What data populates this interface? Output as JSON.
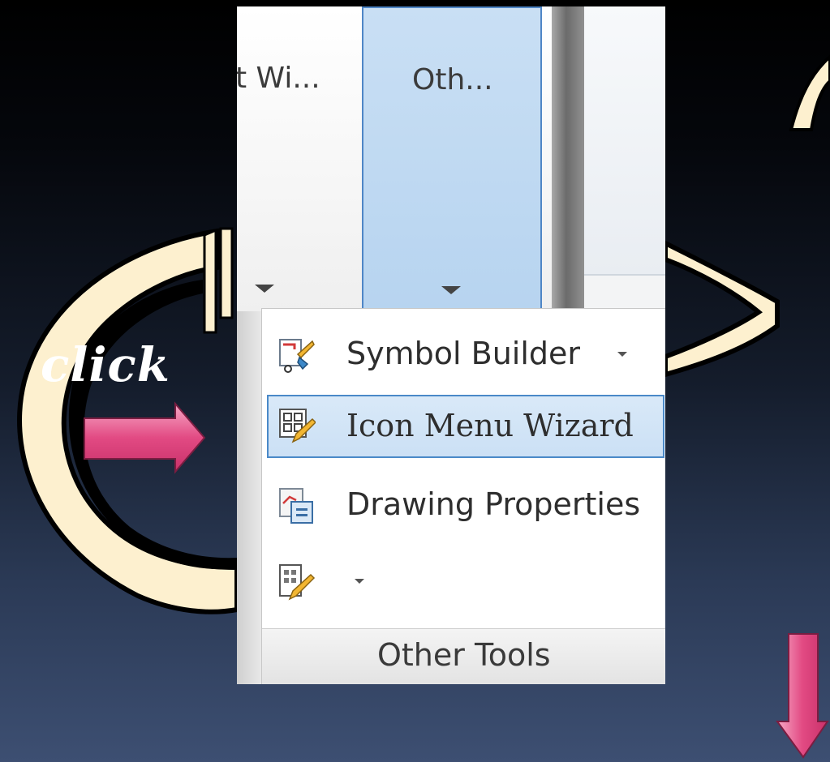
{
  "annotation": {
    "click_label": "click"
  },
  "ribbon": {
    "buttons": [
      {
        "label": "it Wi...",
        "icon": "chevron-down-icon"
      },
      {
        "label": "Oth...",
        "icon": "chevron-down-icon",
        "state": "active"
      }
    ]
  },
  "menu": {
    "items": [
      {
        "label": "Symbol Builder",
        "icon": "symbol-builder-icon",
        "has_dropdown": true
      },
      {
        "label": "Icon Menu  Wizard",
        "icon": "icon-menu-wizard-icon",
        "highlighted": true
      },
      {
        "label": "Drawing  Properties",
        "icon": "drawing-properties-icon"
      },
      {
        "label": "",
        "icon": "editor-icon",
        "has_dropdown": true
      }
    ],
    "panel_title": "Other Tools"
  },
  "colors": {
    "swoosh": "#fdf0cf",
    "pointer_arrow": "#e0467f",
    "highlight_border": "#4a89c8",
    "highlight_fill": "#cde2f6"
  }
}
